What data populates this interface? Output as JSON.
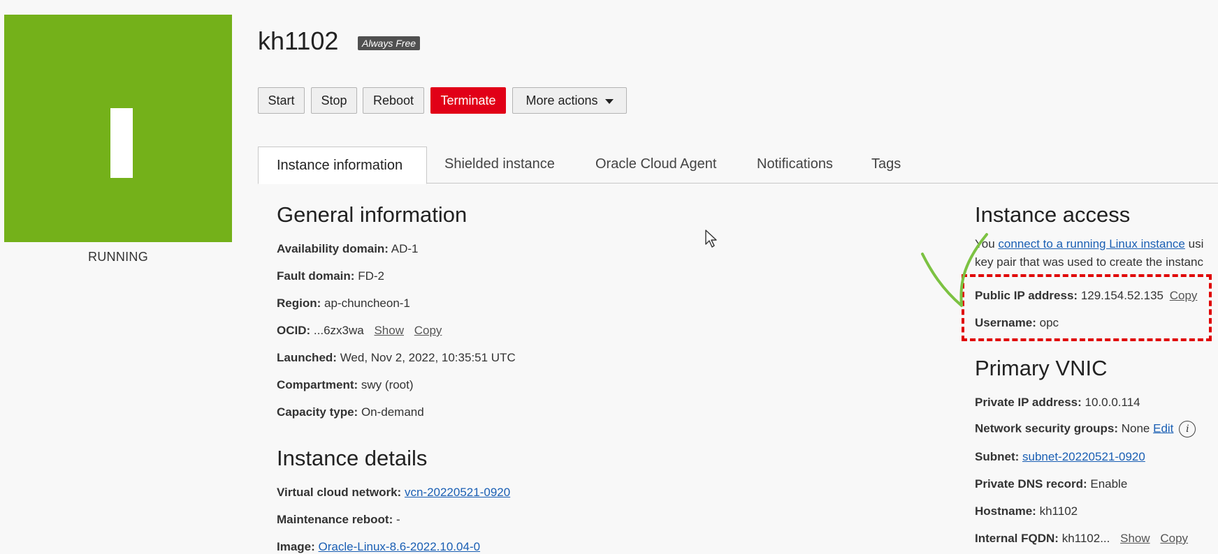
{
  "status": {
    "label": "RUNNING",
    "color": "#74b11a"
  },
  "header": {
    "title": "kh1102",
    "badge": "Always Free"
  },
  "actions": {
    "start": "Start",
    "stop": "Stop",
    "reboot": "Reboot",
    "terminate": "Terminate",
    "more": "More actions"
  },
  "tabs": [
    "Instance information",
    "Shielded instance",
    "Oracle Cloud Agent",
    "Notifications",
    "Tags"
  ],
  "general": {
    "title": "General information",
    "availability_label": "Availability domain:",
    "availability_value": "AD-1",
    "fault_label": "Fault domain:",
    "fault_value": "FD-2",
    "region_label": "Region:",
    "region_value": "ap-chuncheon-1",
    "ocid_label": "OCID:",
    "ocid_value": "...6zx3wa",
    "launched_label": "Launched:",
    "launched_value": "Wed, Nov 2, 2022, 10:35:51 UTC",
    "compartment_label": "Compartment:",
    "compartment_value": "swy (root)",
    "capacity_label": "Capacity type:",
    "capacity_value": "On-demand"
  },
  "details": {
    "title": "Instance details",
    "vcn_label": "Virtual cloud network:",
    "vcn_value": "vcn-20220521-0920",
    "maint_label": "Maintenance reboot:",
    "maint_value": "-",
    "image_label": "Image:",
    "image_value": "Oracle-Linux-8.6-2022.10.04-0"
  },
  "access": {
    "title": "Instance access",
    "line1_prefix": "You ",
    "line1_link": "connect to a running Linux instance",
    "line1_suffix": " usi",
    "line2": "key pair that was used to create the instanc",
    "public_ip_label": "Public IP address:",
    "public_ip_value": "129.154.52.135",
    "username_label": "Username:",
    "username_value": "opc"
  },
  "vnic": {
    "title": "Primary VNIC",
    "private_ip_label": "Private IP address:",
    "private_ip_value": "10.0.0.114",
    "nsg_label": "Network security groups:",
    "nsg_value": "None",
    "nsg_edit": "Edit",
    "subnet_label": "Subnet:",
    "subnet_value": "subnet-20220521-0920",
    "dns_label": "Private DNS record:",
    "dns_value": "Enable",
    "hostname_label": "Hostname:",
    "hostname_value": "kh1102",
    "fqdn_label": "Internal FQDN:",
    "fqdn_value": "kh1102..."
  },
  "common": {
    "show": "Show",
    "copy": "Copy",
    "info_glyph": "i"
  },
  "colors": {
    "terminate": "#e10017",
    "link": "#1a5fb4",
    "highlight": "#e00000",
    "annotation": "#7cc242"
  }
}
